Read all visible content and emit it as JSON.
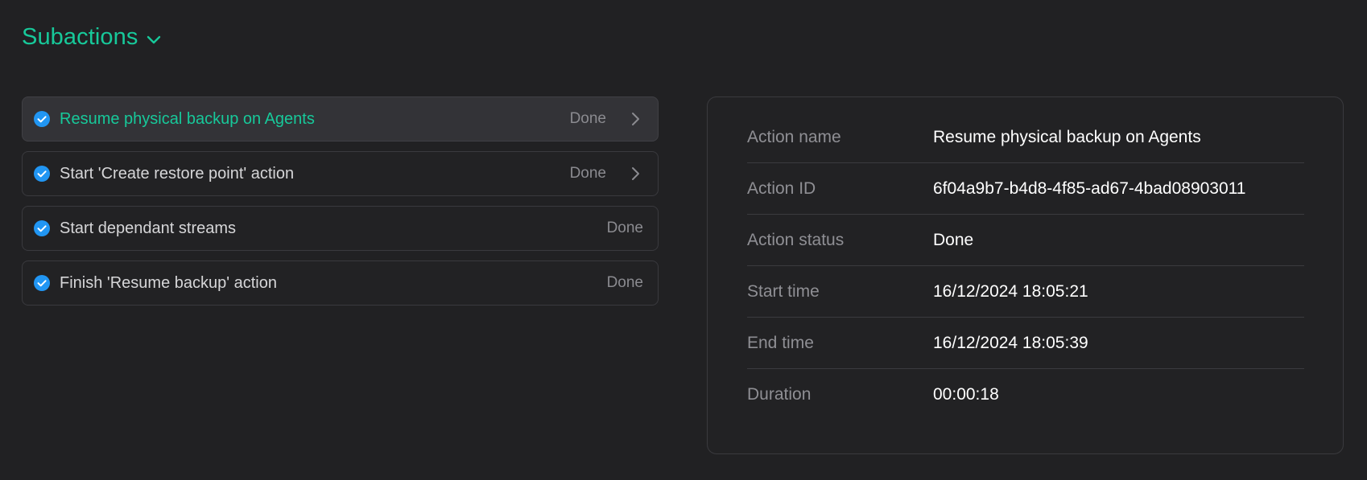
{
  "section": {
    "title": "Subactions",
    "icon": "chevron-down-icon"
  },
  "colors": {
    "accent": "#17c99a",
    "check": "#2196f3",
    "background": "#212123"
  },
  "subactions": [
    {
      "label": "Resume physical backup on Agents",
      "status": "Done",
      "selected": true,
      "has_details": true
    },
    {
      "label": "Start 'Create restore point' action",
      "status": "Done",
      "selected": false,
      "has_details": true
    },
    {
      "label": "Start dependant streams",
      "status": "Done",
      "selected": false,
      "has_details": false
    },
    {
      "label": "Finish 'Resume backup' action",
      "status": "Done",
      "selected": false,
      "has_details": false
    }
  ],
  "details": [
    {
      "label": "Action name",
      "value": "Resume physical backup on Agents"
    },
    {
      "label": "Action ID",
      "value": "6f04a9b7-b4d8-4f85-ad67-4bad08903011"
    },
    {
      "label": "Action status",
      "value": "Done"
    },
    {
      "label": "Start time",
      "value": "16/12/2024 18:05:21"
    },
    {
      "label": "End time",
      "value": "16/12/2024 18:05:39"
    },
    {
      "label": "Duration",
      "value": "00:00:18"
    }
  ]
}
